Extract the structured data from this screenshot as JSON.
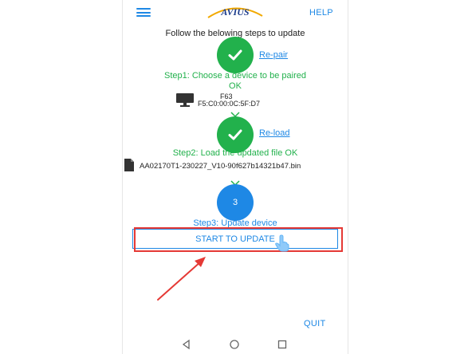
{
  "header": {
    "logo_text": "AVIUS",
    "help_label": "HELP"
  },
  "instructions": "Follow the belowing steps to update",
  "step1": {
    "link_label": "Re-pair",
    "text_line1": "Step1: Choose a device to be paired",
    "text_line2": "OK",
    "device_name": "F63",
    "device_mac": "F5:C0:00:0C:5F:D7"
  },
  "step2": {
    "link_label": "Re-load",
    "text": "Step2: Load the updated file OK",
    "file_name": "AA02170T1-230227_V10-90f627b14321b47.bin"
  },
  "step3": {
    "number": "3",
    "text": "Step3: Update device",
    "button_label": "START TO UPDATE"
  },
  "footer": {
    "quit_label": "QUIT"
  },
  "colors": {
    "accent": "#1e88e5",
    "success": "#22b14c",
    "annotation": "#e53935"
  },
  "icons": [
    "menu-icon",
    "check-icon",
    "monitor-icon",
    "chevron-down-icon",
    "file-icon",
    "hand-pointer-icon",
    "back-icon",
    "home-icon",
    "recents-icon"
  ]
}
